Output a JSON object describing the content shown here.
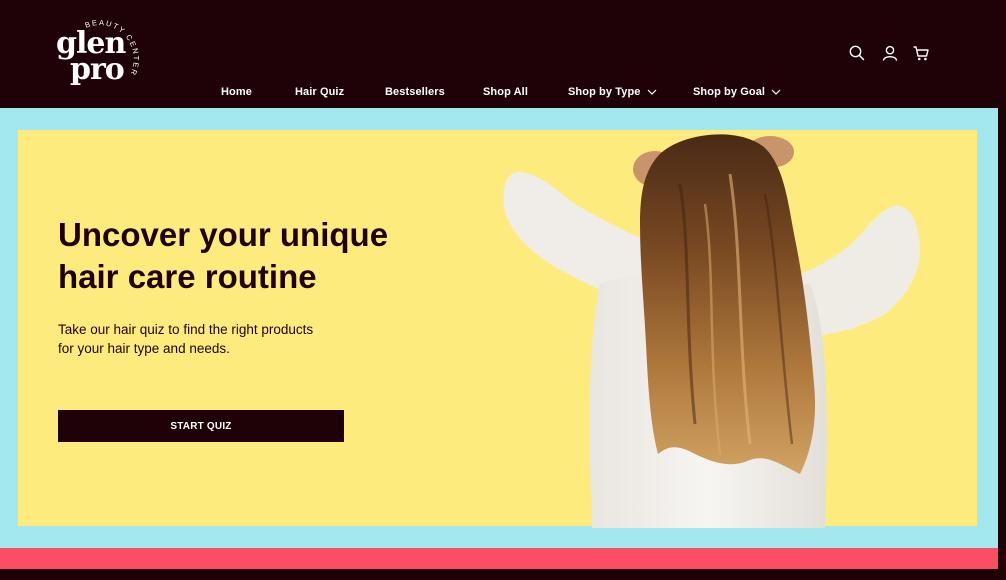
{
  "brand": {
    "logo_line1": "glen",
    "logo_line2": "pro",
    "logo_ring_text": "BEAUTY CENTER"
  },
  "nav": {
    "items": [
      {
        "label": "Home"
      },
      {
        "label": "Hair Quiz"
      },
      {
        "label": "Bestsellers"
      },
      {
        "label": "Shop All"
      },
      {
        "label": "Shop by Type",
        "dropdown": true
      },
      {
        "label": "Shop by Goal",
        "dropdown": true
      }
    ]
  },
  "header_icons": [
    "search-icon",
    "account-icon",
    "cart-icon"
  ],
  "hero": {
    "headline_line1": "Uncover your unique",
    "headline_line2": "hair care routine",
    "subtext_line1": "Take our hair quiz to find the right products",
    "subtext_line2": "for your hair type and needs.",
    "cta_label": "START QUIZ"
  },
  "colors": {
    "header_bg": "#1e0208",
    "hero_frame": "#a3e8ee",
    "hero_bg": "#fdec7d",
    "accent_stripe": "#fb4e64",
    "cta_bg": "#1e0208"
  }
}
